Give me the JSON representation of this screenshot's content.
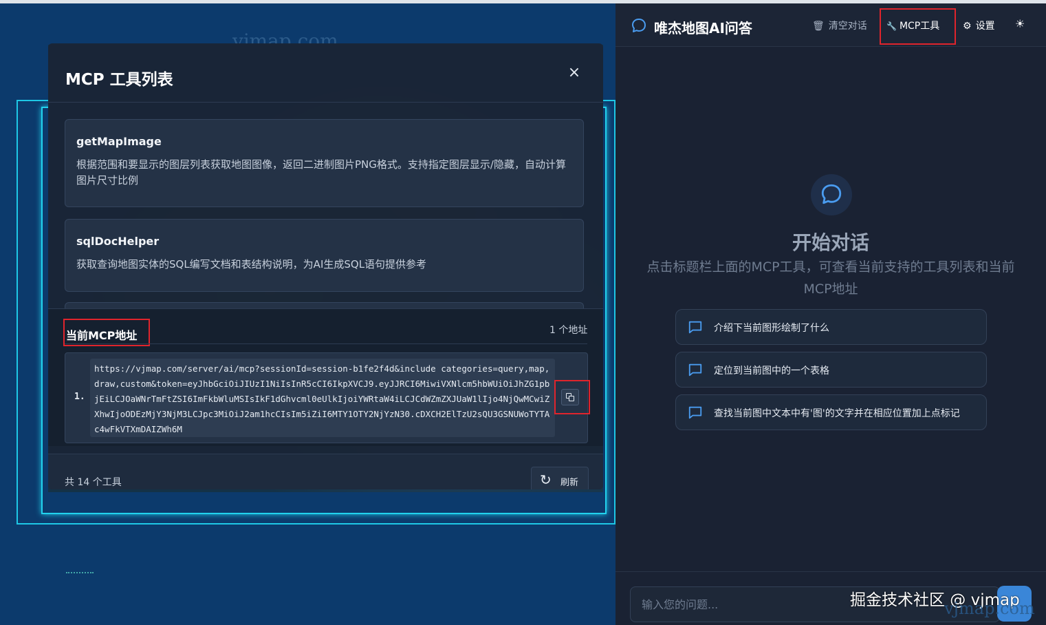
{
  "map": {
    "watermark": "vjmap.com"
  },
  "modal": {
    "title": "MCP 工具列表",
    "close_icon": "×",
    "tools": [
      {
        "name": "getMapImage",
        "description": "根据范围和要显示的图层列表获取地图图像，返回二进制图片PNG格式。支持指定图层显示/隐藏，自动计算图片尺寸比例"
      },
      {
        "name": "sqlDocHelper",
        "description": "获取查询地图实体的SQL编写文档和表结构说明，为AI生成SQL语句提供参考"
      }
    ],
    "address_section": {
      "title": "当前MCP地址",
      "count": "1 个地址",
      "items": [
        {
          "index": "1.",
          "url": "https://vjmap.com/server/ai/mcp?sessionId=session-b1fe2f4d&include categories=query,map,draw,custom&token=eyJhbGciOiJIUzI1NiIsInR5cCI6IkpXVCJ9.eyJJRCI6MiwiVXNlcm5hbWUiOiJhZG1pbjEiLCJOaWNrTmFtZSI6ImFkbWluMSIsIkF1dGhvcml0eUlkIjoiYWRtaW4iLCJCdWZmZXJUaW1lIjo4NjQwMCwiZXhwIjoODEzMjY3NjM3LCJpc3MiOiJ2am1hcCIsIm5iZiI6MTY1OTY2NjYzN30.cDXCH2ElTzU2sQU3GSNUWoTYTAc4wFkVTXmDAIZWh6M"
        }
      ]
    },
    "footer": {
      "count": "共 14 个工具",
      "refresh_label": "刷新",
      "refresh_icon": "↻"
    }
  },
  "chat": {
    "title": "唯杰地图AI问答",
    "header_buttons": {
      "clear": "清空对话",
      "clear_icon": "🗑",
      "mcp": "MCP工具",
      "mcp_icon": "🔧",
      "settings": "设置",
      "settings_icon": "⚙",
      "theme_icon": "☀"
    },
    "empty_state": {
      "title": "开始对话",
      "description": "点击标题栏上面的MCP工具，可查看当前支持的工具列表和当前MCP地址"
    },
    "suggestions": [
      "介绍下当前图形绘制了什么",
      "定位到当前图中的一个表格",
      "查找当前图中文本中有'图'的文字并在相应位置加上点标记"
    ],
    "input": {
      "placeholder": "输入您的问题..."
    }
  },
  "watermarks": {
    "juejin": "掘金技术社区 @ vjmap",
    "vjmap": "vjmap.com"
  },
  "colors": {
    "highlight_red": "#e0242c",
    "accent_blue": "#3a86d8",
    "frame_cyan": "#1ec8e6"
  }
}
